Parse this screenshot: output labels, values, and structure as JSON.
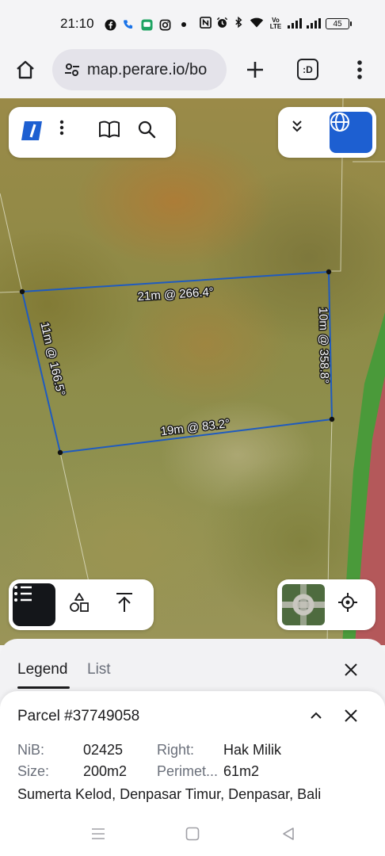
{
  "status_bar": {
    "time": "21:10",
    "battery": "45",
    "network_label": "Vo LTE",
    "icons": [
      "facebook-icon",
      "phone-icon",
      "messages-icon",
      "instagram-icon",
      "dot-icon",
      "nfc-icon",
      "alarm-icon",
      "bluetooth-icon",
      "wifi-icon",
      "signal-icon"
    ]
  },
  "browser": {
    "url": "map.perare.io/bo",
    "tab_badge": ":D",
    "icons": [
      "home-icon",
      "site-settings-icon",
      "plus-icon",
      "tabs-icon",
      "more-vert-icon"
    ]
  },
  "map": {
    "toolbar_icons": [
      "logo-icon",
      "more-vert-icon",
      "book-icon",
      "search-icon"
    ],
    "layer_icons": [
      "chevron-double-down-icon",
      "globe-icon"
    ],
    "parcel_edges": [
      {
        "label": "21m @ 266.4°"
      },
      {
        "label": "10m @ 358.8°"
      },
      {
        "label": "19m @ 83.2°"
      },
      {
        "label": "11m @ 166.5°"
      }
    ],
    "colors": {
      "parcel_outline": "#1f5bbf",
      "accent": "#1d5fd1",
      "road_green": "#4a9a3a",
      "road_red": "#b4585a"
    }
  },
  "legend_panel": {
    "tabs": [
      {
        "label": "Legend",
        "active": true
      },
      {
        "label": "List",
        "active": false
      }
    ]
  },
  "parcel": {
    "title": "Parcel #37749058",
    "fields": {
      "nib_label": "NiB:",
      "nib_value": "02425",
      "right_label": "Right:",
      "right_value": "Hak Milik",
      "size_label": "Size:",
      "size_value": "200m2",
      "perimeter_label": "Perimet...",
      "perimeter_value": "61m2"
    },
    "address": "Sumerta Kelod, Denpasar Timur, Denpasar, Bali"
  },
  "nav_bar": {
    "icons": [
      "recents-icon",
      "home-nav-icon",
      "back-icon"
    ]
  }
}
